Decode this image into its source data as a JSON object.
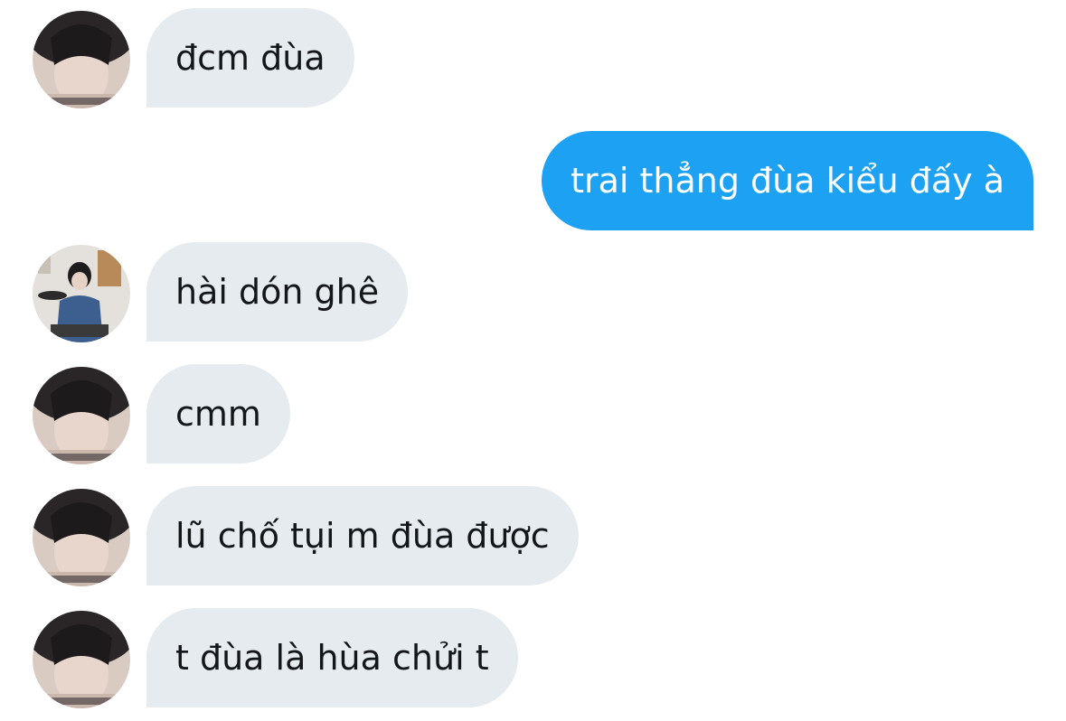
{
  "colors": {
    "incoming_bubble": "#e6ebef",
    "outgoing_bubble": "#1da1f2",
    "incoming_text": "#14171a",
    "outgoing_text": "#ffffff",
    "background": "#ffffff"
  },
  "messages": [
    {
      "direction": "incoming",
      "avatar": "user-photo-avatar",
      "text": "đcm đùa"
    },
    {
      "direction": "outgoing",
      "text": "trai thẳng đùa kiểu đấy à"
    },
    {
      "direction": "incoming",
      "avatar": "drummer-photo-avatar",
      "text": "hài dón ghê"
    },
    {
      "direction": "incoming",
      "avatar": "user-photo-avatar",
      "text": "cmm"
    },
    {
      "direction": "incoming",
      "avatar": "user-photo-avatar",
      "text": "lũ chố tụi m đùa được"
    },
    {
      "direction": "incoming",
      "avatar": "user-photo-avatar",
      "text": "t đùa là hùa chửi t"
    }
  ]
}
